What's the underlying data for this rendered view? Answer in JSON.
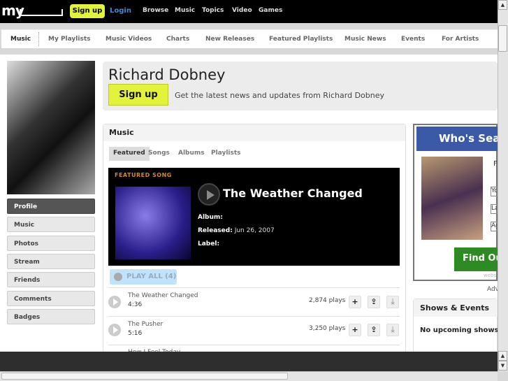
{
  "topbar": {
    "logo": "my",
    "signup": "Sign up",
    "login": "Login",
    "nav": [
      "Browse",
      "Music",
      "Topics",
      "Video",
      "Games"
    ]
  },
  "subnav": [
    "Music",
    "My Playlists",
    "Music Videos",
    "Charts",
    "New Releases",
    "Featured Playlists",
    "Music News",
    "Events",
    "For Artists"
  ],
  "sidebar": [
    "Profile",
    "Music",
    "Photos",
    "Stream",
    "Friends",
    "Comments",
    "Badges"
  ],
  "header": {
    "name": "Richard Dobney",
    "signup": "Sign up",
    "tagline": "Get the latest news and updates from Richard Dobney"
  },
  "music": {
    "title": "Music",
    "tabs": [
      "Featured",
      "Songs",
      "Albums",
      "Playlists"
    ],
    "featured": {
      "label": "FEATURED SONG",
      "title": "The Weather Changed",
      "album_label": "Album:",
      "released_label": "Released:",
      "released": "Jun 26, 2007",
      "label_label": "Label:"
    },
    "play_all": "PLAY ALL (4)",
    "songs": [
      {
        "title": "The Weather Changed",
        "duration": "4:36",
        "plays": "2,874 plays"
      },
      {
        "title": "The Pusher",
        "duration": "5:16",
        "plays": "3,250 plays"
      },
      {
        "title": "How I Feel Today"
      }
    ]
  },
  "ad": {
    "headline": "Who's Sear",
    "field_label": "F",
    "inputs": [
      "Yo",
      "La",
      "Ag"
    ],
    "button": "Find Ou",
    "source": "webs",
    "advert_label": "Adv"
  },
  "shows": {
    "title": "Shows & Events",
    "empty": "No upcoming shows/events"
  },
  "colors": {
    "accent_yellow": "#e3f23a",
    "link_blue": "#3a8be0",
    "featured_orange": "#d88a1a",
    "ad_blue": "#3a5aa8",
    "ad_green": "#2e8a22"
  }
}
